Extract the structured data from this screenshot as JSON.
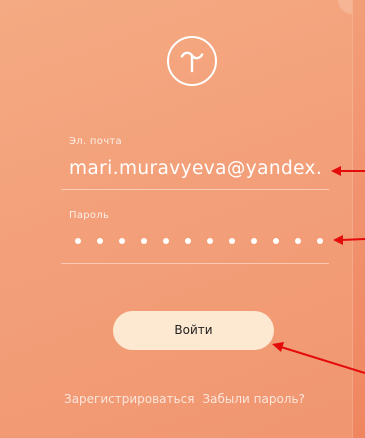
{
  "login_form": {
    "email_label": "Эл. почта",
    "email_value": "mari.muravyeva@yandex.ru",
    "password_label": "Пароль",
    "password_mask_length": 12,
    "submit_label": "Войти"
  },
  "footer_links": {
    "register": "Зарегистрироваться",
    "forgot_password": "Забыли пароль?"
  },
  "colors": {
    "background": "#f29673",
    "button": "#fde8d1",
    "annotation_arrow": "#e40b0b"
  },
  "icons": {
    "logo": "tilda-logo-icon"
  }
}
